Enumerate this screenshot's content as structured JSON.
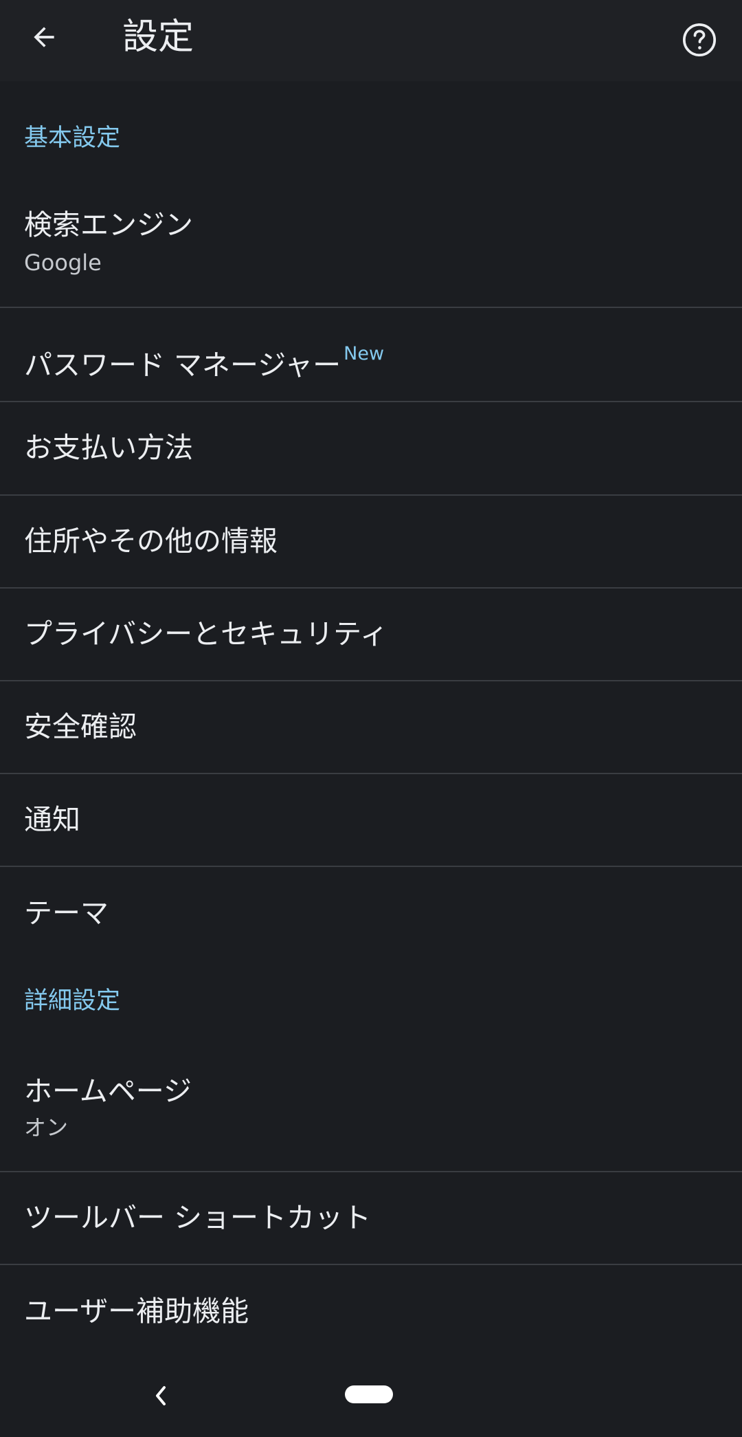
{
  "appbar": {
    "title": "設定",
    "back_icon": "arrow-left-icon",
    "help_icon": "help-circle-icon"
  },
  "sections": {
    "basic": {
      "header": "基本設定"
    },
    "advanced": {
      "header": "詳細設定"
    }
  },
  "items": {
    "search_engine": {
      "title": "検索エンジン",
      "subtitle": "Google"
    },
    "password_manager": {
      "title": "パスワード マネージャー",
      "badge": "New"
    },
    "payment_methods": {
      "title": "お支払い方法"
    },
    "addresses": {
      "title": "住所やその他の情報"
    },
    "privacy": {
      "title": "プライバシーとセキュリティ"
    },
    "safety_check": {
      "title": "安全確認"
    },
    "notifications": {
      "title": "通知"
    },
    "theme": {
      "title": "テーマ"
    },
    "homepage": {
      "title": "ホームページ",
      "subtitle": "オン"
    },
    "toolbar_shortcut": {
      "title": "ツールバー ショートカット"
    },
    "accessibility": {
      "title": "ユーザー補助機能"
    }
  },
  "colors": {
    "background": "#1b1d21",
    "appbar": "#1f2125",
    "accent": "#84c9ee",
    "text": "#eceef1",
    "divider": "#3a3d42"
  },
  "navbar": {
    "back_icon": "nav-back-chevron-icon",
    "home_icon": "home-pill-icon"
  }
}
